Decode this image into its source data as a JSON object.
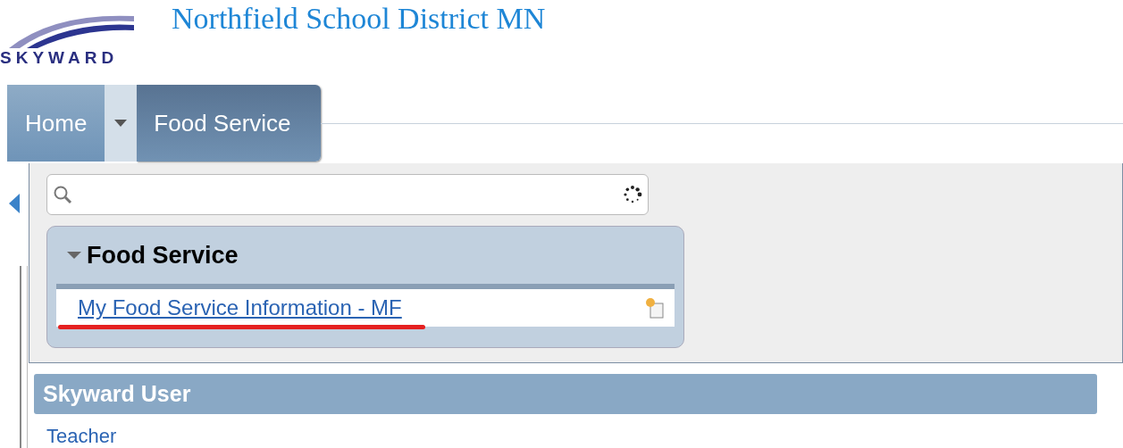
{
  "header": {
    "logo_text": "SKYWARD",
    "title": "Northfield School District MN"
  },
  "tabs": [
    {
      "kind": "tab",
      "label": "Home",
      "selected": false
    },
    {
      "kind": "dropdown",
      "selected": false
    },
    {
      "kind": "tab",
      "label": "Food Service",
      "selected": true
    }
  ],
  "menu_group": {
    "title": "Food Service",
    "expanded": true,
    "items": [
      {
        "label": "My Food Service Information - MF",
        "highlighted": true
      }
    ]
  },
  "section": {
    "title": "Skyward User",
    "links": [
      "Teacher"
    ]
  }
}
